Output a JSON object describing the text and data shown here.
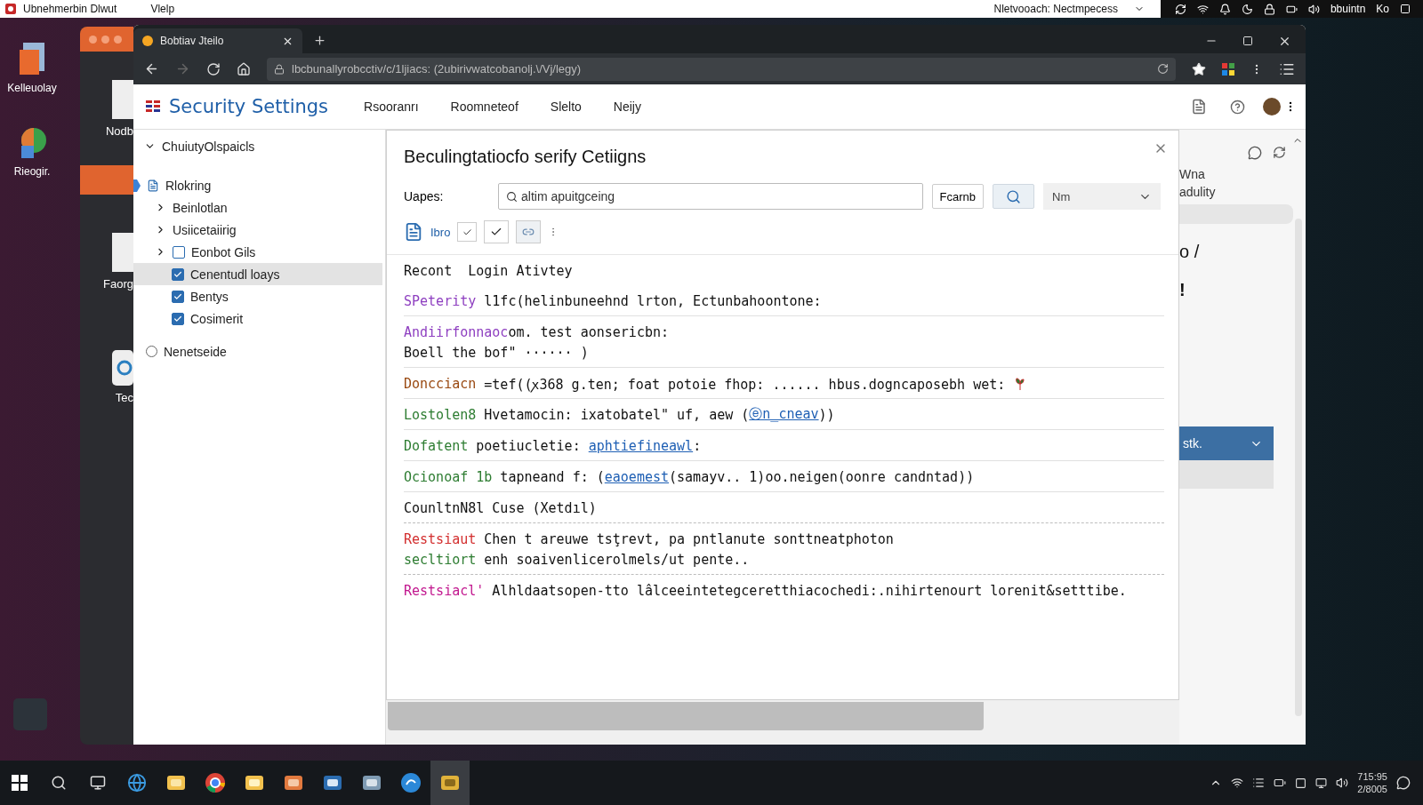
{
  "topbar": {
    "app_name": "Ubnehmerbin Dlwut",
    "menu": [
      "Vlelp"
    ],
    "status_text": "Nletvooach: Nectmpecess",
    "user": "bbuintn",
    "lang": "Ko"
  },
  "desktop_icons": [
    {
      "label": "Kelleuolay"
    },
    {
      "label": "Rieogir."
    }
  ],
  "back_window": {
    "labels": [
      "Nodb",
      "Faorg",
      "Tec"
    ]
  },
  "browser": {
    "tab_title": "Bobtiav Jteilo",
    "url": "lbcbunallyrobcctiv/c/1ljiacs: (2ubirivwatcobanolj.\\/Vj/legy)"
  },
  "header": {
    "title": "Security Settings",
    "nav": [
      "Rsooranrı",
      "Roomneteof",
      "Slelto",
      "Neijy"
    ]
  },
  "sidebar": {
    "section": {
      "label": "ChuiutyOlspaicls",
      "expanded": true,
      "children": [
        {
          "label": "Rlokring",
          "children": [
            {
              "label": "Beinlotlan",
              "expanded": false,
              "selected": false
            },
            {
              "label": "Usiicetaiirig",
              "expanded": false,
              "selected": false
            },
            {
              "label": "Eonbot Gils",
              "expanded": false,
              "checked": false,
              "selected": false
            },
            {
              "label": "Cenentudl loays",
              "checked": true,
              "selected": true
            },
            {
              "label": "Bentys",
              "checked": true,
              "selected": false
            },
            {
              "label": "Cosimerit",
              "checked": true,
              "selected": false
            }
          ]
        }
      ]
    },
    "radio": {
      "label": "Nenetseide",
      "selected": false
    }
  },
  "dialog": {
    "title": "Beculingtatiocfo serify Cetiigns",
    "filter_label": "Uapes:",
    "search_value": "altim apuitgceing",
    "button": "Fcarnb",
    "dropdown": "Nm",
    "toolbar_label": "Ibro",
    "heading": "Recont  Login Ativtey",
    "lines": [
      {
        "kind": "ruled",
        "parts": [
          {
            "kind": "label",
            "text": "SPeterity",
            "color": "#8e3fc0"
          },
          {
            "kind": "text",
            "text": " l1fc(helinbuneehnd lrton, Ectunbahoontone:"
          }
        ]
      },
      {
        "kind": "plain",
        "parts": [
          {
            "kind": "label",
            "text": "Andiirfonnaoc",
            "color": "#8e3fc0"
          },
          {
            "kind": "text",
            "text": "om. test aonsericbn:"
          }
        ]
      },
      {
        "kind": "ruled",
        "parts": [
          {
            "kind": "text",
            "text": "Boell the bof\" ······ )"
          }
        ]
      },
      {
        "kind": "ruled",
        "icon": true,
        "parts": [
          {
            "kind": "label",
            "text": "Doncciacn",
            "color": "#9a4a12"
          },
          {
            "kind": "text",
            "text": " =tef((ꭗ368 g.ten; foat potoie fhop: ...... hbus.dogncaposebh wet:"
          }
        ]
      },
      {
        "kind": "ruled",
        "parts": [
          {
            "kind": "label",
            "text": "Lostolen8",
            "color": "#2e7d32"
          },
          {
            "kind": "text",
            "text": " Hvetamocin: ixatobatel\" uf, aew ("
          },
          {
            "kind": "link",
            "text": "ⓔn_cneav"
          },
          {
            "kind": "text",
            "text": "))"
          }
        ]
      },
      {
        "kind": "ruled",
        "parts": [
          {
            "kind": "label",
            "text": "Dofatent",
            "color": "#2e7d32"
          },
          {
            "kind": "text",
            "text": " poetiucletie: "
          },
          {
            "kind": "link",
            "text": "aphtiefineawl"
          },
          {
            "kind": "text",
            "text": ":"
          }
        ]
      },
      {
        "kind": "ruled",
        "parts": [
          {
            "kind": "label",
            "text": "Ocionoaf 1b",
            "color": "#2e7d32"
          },
          {
            "kind": "text",
            "text": " tapneand f: ("
          },
          {
            "kind": "link",
            "text": "eaoemest"
          },
          {
            "kind": "text",
            "text": "(samayv.. 1)oo.neigen(oonre candntad))"
          }
        ]
      },
      {
        "kind": "dashed",
        "parts": [
          {
            "kind": "text",
            "text": "CounltnN8l Cuse (Xetdıl)"
          }
        ]
      },
      {
        "kind": "plain",
        "parts": [
          {
            "kind": "label",
            "text": "Restsiaut",
            "color": "#d32f2f"
          },
          {
            "kind": "text",
            "text": " Chen t areuwe tsţrevt, pa pntlanute sonttneatphoton"
          }
        ]
      },
      {
        "kind": "dashed",
        "parts": [
          {
            "kind": "label",
            "text": "secltiort",
            "color": "#2e7d32"
          },
          {
            "kind": "text",
            "text": " enh soaivenlicerolmels/ut pente.."
          }
        ]
      },
      {
        "kind": "plain",
        "parts": [
          {
            "kind": "label",
            "text": "Restsiacl'",
            "color": "#c2188f"
          },
          {
            "kind": "text",
            "text": " Alhldaatsopen-tto lâlceeintetegceretthiacochedi:.nihirtenourt lorenit&setttibe."
          }
        ]
      }
    ]
  },
  "right_panel": {
    "texts": [
      "Wna",
      "adulity"
    ],
    "heading": "o /",
    "mark": "!",
    "dropdown": "stk."
  },
  "taskbar": {
    "time": "715:95",
    "date": "2/8005"
  }
}
